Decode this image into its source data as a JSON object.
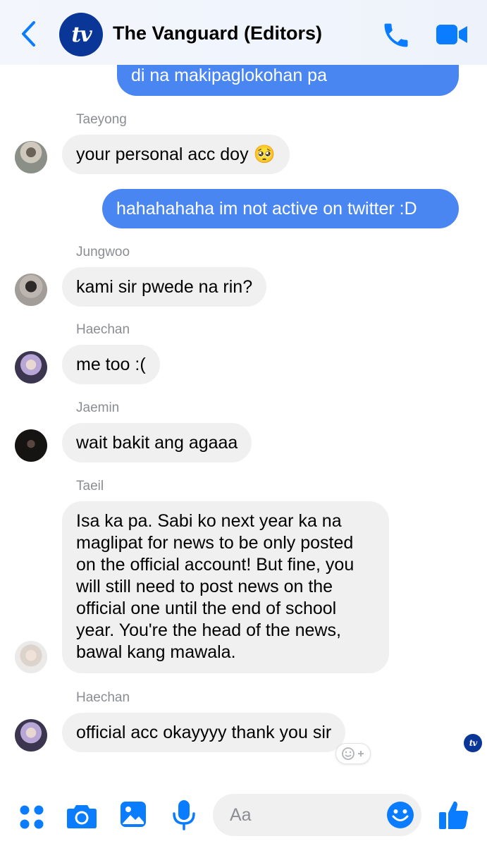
{
  "header": {
    "title": "The Vanguard (Editors)",
    "avatar_text": "tv"
  },
  "messages": [
    {
      "type": "outgoing",
      "text": "di na makipaglokohan pa"
    },
    {
      "type": "incoming",
      "sender": "Taeyong",
      "text": "your personal acc doy 🥺"
    },
    {
      "type": "outgoing",
      "text": "hahahahaha im not active on twitter :D"
    },
    {
      "type": "incoming",
      "sender": "Jungwoo",
      "text": "kami sir pwede na rin?"
    },
    {
      "type": "incoming",
      "sender": "Haechan",
      "text": "me too :("
    },
    {
      "type": "incoming",
      "sender": "Jaemin",
      "text": "wait bakit ang agaaa"
    },
    {
      "type": "incoming",
      "sender": "Taeil",
      "text": "Isa ka pa. Sabi ko next year ka na maglipat for news to be only posted on the official account! But fine, you will still need to post news on the official one until the end of school year. You're the head of the news, bawal kang mawala."
    },
    {
      "type": "incoming",
      "sender": "Haechan",
      "text": "official acc okayyyy thank you sir"
    }
  ],
  "seen_avatar_text": "tv",
  "composer": {
    "placeholder": "Aa"
  },
  "colors": {
    "accent": "#0a7cff",
    "outgoing_bubble": "#4a86f2",
    "incoming_bubble": "#f0f0f0",
    "brand": "#0a3697"
  },
  "icons": [
    "back-icon",
    "phone-icon",
    "video-icon",
    "apps-icon",
    "camera-icon",
    "gallery-icon",
    "microphone-icon",
    "emoji-icon",
    "like-icon",
    "add-reaction-icon"
  ]
}
